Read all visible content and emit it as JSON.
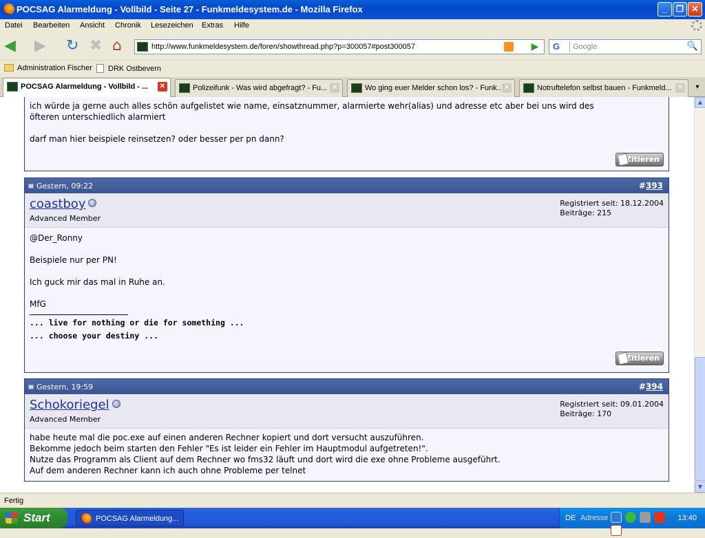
{
  "window": {
    "title": "POCSAG Alarmeldung - Vollbild - Seite 27 - Funkmeldesystem.de - Mozilla Firefox",
    "btn_minimize": "_",
    "btn_maximize": "❐",
    "btn_close": "✕"
  },
  "menu": [
    "Datei",
    "Bearbeiten",
    "Ansicht",
    "Chronik",
    "Lesezeichen",
    "Extras",
    "Hilfe"
  ],
  "nav": {
    "back_icon": "◀",
    "forward_icon": "▶",
    "reload_icon": "↻",
    "stop_icon": "✖",
    "home_icon": "⌂",
    "url": "http://www.funkmeldesystem.de/foren/showthread.php?p=300057#post300057",
    "go_icon": "▶",
    "search_engine": "G",
    "search_placeholder": "Google",
    "search_icon": "🔍"
  },
  "bookmarks": [
    "Administration Fischer",
    "DRK Ostbevern"
  ],
  "tabs": [
    {
      "label": "POCSAG Alarmeldung - Vollbild - ...",
      "active": true
    },
    {
      "label": "Polizeifunk - Was wird abgefragt? - Fu...",
      "active": false
    },
    {
      "label": "Wo ging euer Melder schon los? - Funk...",
      "active": false
    },
    {
      "label": "Notruftelefon selbst bauen - Funkmeld...",
      "active": false
    }
  ],
  "tab_close": "✕",
  "tabs_more": "▾",
  "post_top": {
    "lines": [
      "ich würde ja gerne auch alles schön aufgelistet wie name, einsatznummer, alarmierte wehr(alias) und adresse etc aber bei uns wird des",
      "öfteren unterschiedlich alarmiert",
      "darf man hier beispiele reinsetzen? oder besser per pn dann?"
    ],
    "quote_label": "Zitieren"
  },
  "post_393": {
    "date": "Gestern, 09:22",
    "hash": "#",
    "number": "393",
    "username": "coastboy",
    "user_title": "Advanced Member",
    "registered": "Registriert seit: 18.12.2004",
    "posts": "Beiträge: 215",
    "lines": [
      "@Der_Ronny",
      "Beispiele nur per PN!",
      "Ich guck mir das mal in Ruhe an.",
      "MfG"
    ],
    "sig1": "... live for nothing or die for something ...",
    "sig2": "... choose your destiny ...",
    "quote_label": "Zitieren"
  },
  "post_394": {
    "date": "Gestern, 19:59",
    "hash": "#",
    "number": "394",
    "username": "Schokoriegel",
    "user_title": "Advanced Member",
    "registered": "Registriert seit: 09.01.2004",
    "posts": "Beiträge: 170",
    "lines": [
      "habe heute mal die poc.exe auf einen anderen Rechner kopiert und dort versucht auszuführen.",
      "Bekomme jedoch beim starten den Fehler \"Es ist leider ein Fehler im Hauptmodul aufgetreten!\".",
      "Nutze das Programm als Client auf dem Rechner wo fms32 läuft und dort wird die exe ohne Probleme ausgeführt.",
      "Auf dem anderen Rechner kann ich auch ohne Probleme per telnet"
    ]
  },
  "status": "Fertig",
  "taskbar": {
    "start": "Start",
    "task_label": "POCSAG Alarmeldung...",
    "lang": "DE",
    "address": "Adresse",
    "clock": "13:40"
  },
  "scroll": {
    "up": "▲",
    "down": "▼"
  }
}
